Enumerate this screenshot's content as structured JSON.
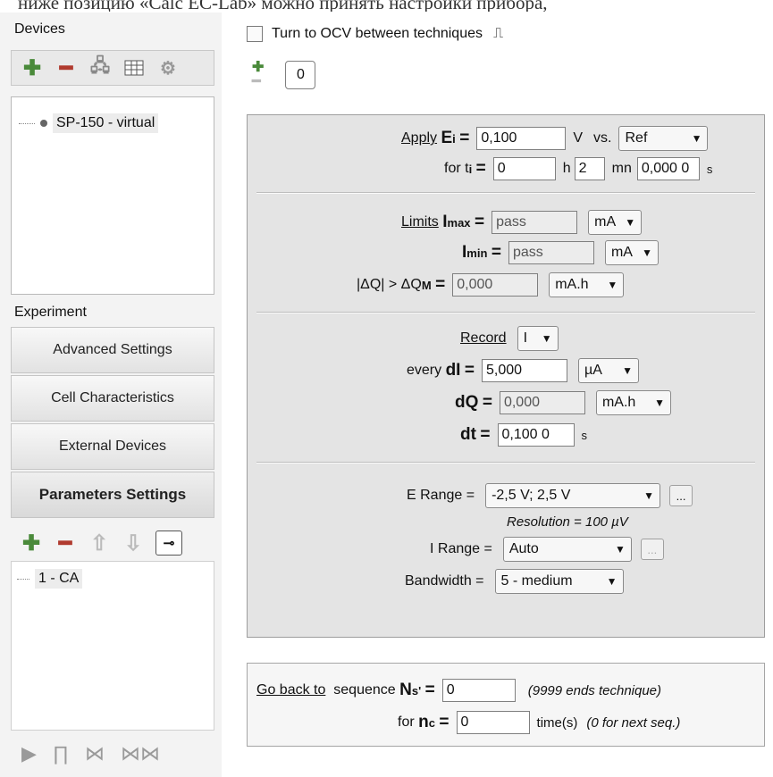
{
  "top_text": "ниже позицию «Calc EC-Lab» можно принять настройки прибора,",
  "left": {
    "devices_label": "Devices",
    "device_item": "SP-150 - virtual",
    "experiment_label": "Experiment",
    "nav": [
      "Advanced Settings",
      "Cell Characteristics",
      "External Devices",
      "Parameters Settings"
    ],
    "technique_item": "1 - CA"
  },
  "top": {
    "ocv_label": "Turn to OCV between techniques",
    "counter_value": "0"
  },
  "apply": {
    "apply_label": "Apply",
    "ei_sym": "E",
    "ei_sub": "i",
    "eq": "=",
    "ei_value": "0,100",
    "ei_unit": "V",
    "vs_label": "vs.",
    "vs_value": "Ref",
    "for_label": "for t",
    "ti_sub": "i",
    "t_h": "0",
    "h_unit": "h",
    "t_mn": "2",
    "mn_unit": "mn",
    "t_s": "0,000 0",
    "s_unit": "s"
  },
  "limits": {
    "limits_label": "Limits",
    "imax_sym": "I",
    "imax_sub": "max",
    "imax_value": "pass",
    "imax_unit": "mA",
    "imin_sym": "I",
    "imin_sub": "min",
    "imin_value": "pass",
    "imin_unit": "mA",
    "dq_label": "|ΔQ| > ΔQ",
    "dq_sub": "M",
    "dq_value": "0,000",
    "dq_unit": "mA.h"
  },
  "record": {
    "record_label": "Record",
    "record_value": "I",
    "every_label": "every",
    "di_sym": "dI",
    "di_value": "5,000",
    "di_unit": "µA",
    "dq_sym": "dQ",
    "dq_value": "0,000",
    "dq_unit": "mA.h",
    "dt_sym": "dt",
    "dt_value": "0,100 0",
    "dt_unit": "s"
  },
  "ranges": {
    "erange_label": "E Range =",
    "erange_value": "-2,5 V; 2,5 V",
    "resolution": "Resolution = 100 µV",
    "irange_label": "I Range =",
    "irange_value": "Auto",
    "bandwidth_label": "Bandwidth =",
    "bandwidth_value": "5 - medium"
  },
  "sequence": {
    "goback_label": "Go back to",
    "sequence_label": "sequence",
    "ns_sym": "N",
    "ns_sub": "s'",
    "ns_value": "0",
    "ns_note": "(9999 ends technique)",
    "for_label": "for",
    "nc_sym": "n",
    "nc_sub": "c",
    "nc_value": "0",
    "nc_unit": "time(s)",
    "nc_note": "(0 for next seq.)"
  },
  "dots_label": "..."
}
